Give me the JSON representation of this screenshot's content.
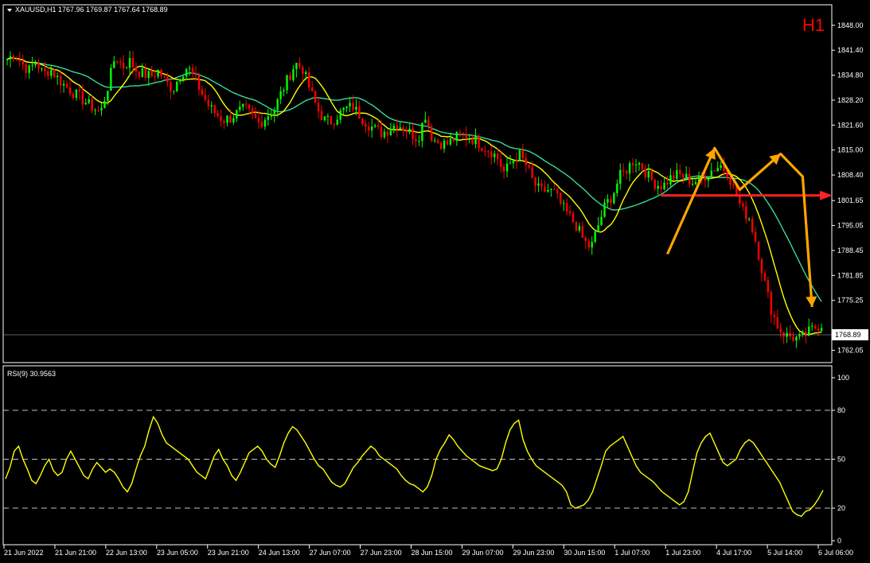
{
  "chart_data": [
    {
      "type": "candlestick",
      "symbol_header": "XAUUSD,H1  1767.96 1769.87 1767.64 1768.89",
      "timeframe_label": "H1",
      "current_price_label": "1768.89",
      "ylim": [
        1759.0,
        1853.0
      ],
      "y_ticks": [
        "1848.00",
        "1841.40",
        "1834.80",
        "1828.20",
        "1821.60",
        "1815.00",
        "1808.40",
        "1801.65",
        "1795.05",
        "1788.45",
        "1781.85",
        "1775.25",
        "1762.05"
      ],
      "x_labels": [
        "21 Jun 2022",
        "21 Jun 21:00",
        "22 Jun 13:00",
        "23 Jun 05:00",
        "23 Jun 21:00",
        "24 Jun 13:00",
        "27 Jun 07:00",
        "27 Jun 23:00",
        "28 Jun 15:00",
        "29 Jun 07:00",
        "29 Jun 23:00",
        "30 Jun 15:00",
        "1 Jul 07:00",
        "1 Jul 23:00",
        "4 Jul 17:00",
        "5 Jul 14:00",
        "6 Jul 06:00"
      ],
      "close_path": [
        1839.0,
        1840.5,
        1838.0,
        1836.0,
        1838.5,
        1835.0,
        1836.5,
        1834.0,
        1832.0,
        1830.5,
        1829.0,
        1827.5,
        1826.0,
        1825.0,
        1832.0,
        1840.0,
        1837.0,
        1838.5,
        1836.0,
        1835.0,
        1834.5,
        1836.0,
        1833.0,
        1831.0,
        1835.0,
        1837.0,
        1834.0,
        1830.0,
        1826.5,
        1824.5,
        1823.0,
        1823.5,
        1825.0,
        1826.0,
        1824.0,
        1822.0,
        1824.0,
        1825.5,
        1830.0,
        1834.0,
        1838.0,
        1836.5,
        1831.0,
        1826.0,
        1823.0,
        1822.5,
        1824.5,
        1826.0,
        1826.5,
        1824.0,
        1822.0,
        1820.5,
        1819.5,
        1820.5,
        1822.0,
        1821.0,
        1819.5,
        1818.0,
        1824.5,
        1818.0,
        1817.0,
        1816.5,
        1818.0,
        1819.0,
        1818.5,
        1817.5,
        1816.0,
        1815.0,
        1813.0,
        1809.0,
        1812.0,
        1814.0,
        1811.0,
        1806.5,
        1804.0,
        1804.5,
        1803.5,
        1800.0,
        1797.5,
        1795.0,
        1791.0,
        1789.0,
        1795.0,
        1800.5,
        1803.0,
        1808.0,
        1810.0,
        1812.5,
        1811.0,
        1808.0,
        1806.0,
        1805.5,
        1807.5,
        1808.5,
        1808.0,
        1806.5,
        1807.0,
        1808.5,
        1810.0,
        1811.0,
        1809.0,
        1804.0,
        1799.0,
        1797.0,
        1790.0,
        1781.0,
        1773.0,
        1768.0,
        1766.0,
        1765.5,
        1765.0,
        1766.5,
        1768.0,
        1768.89
      ],
      "ma_fast_label": "yellow moving average",
      "ma_slow_label": "green moving average",
      "ma_fast_color": "#ffff00",
      "ma_slow_color": "#33dd99",
      "bull_color": "#00ff00",
      "bear_color": "#ff0000",
      "annotation_arrow_color": "#ffa500",
      "support_line_color": "#ff2222",
      "support_level": 1803.0
    },
    {
      "type": "line",
      "label": "RSI(9) 30.9563",
      "ylim": [
        0,
        100
      ],
      "y_ticks": [
        "100",
        "80",
        "50",
        "20",
        "0"
      ],
      "levels": [
        80,
        50,
        20
      ],
      "color": "#ffff00",
      "values": [
        38,
        45,
        55,
        58,
        50,
        44,
        37,
        35,
        40,
        46,
        50,
        43,
        40,
        42,
        50,
        55,
        50,
        45,
        40,
        38,
        44,
        48,
        45,
        42,
        44,
        42,
        38,
        33,
        30,
        35,
        44,
        52,
        58,
        68,
        76,
        72,
        65,
        60,
        58,
        56,
        54,
        52,
        50,
        46,
        42,
        40,
        38,
        45,
        52,
        56,
        50,
        46,
        40,
        37,
        42,
        48,
        54,
        56,
        58,
        55,
        50,
        47,
        45,
        52,
        60,
        66,
        70,
        68,
        64,
        60,
        55,
        50,
        46,
        44,
        40,
        36,
        34,
        33,
        35,
        40,
        45,
        48,
        52,
        55,
        58,
        56,
        52,
        50,
        48,
        46,
        44,
        40,
        37,
        35,
        34,
        32,
        30,
        33,
        40,
        50,
        56,
        60,
        65,
        62,
        58,
        55,
        52,
        50,
        48,
        46,
        45,
        44,
        43,
        44,
        50,
        60,
        68,
        72,
        74,
        62,
        55,
        50,
        46,
        44,
        42,
        40,
        38,
        36,
        34,
        30,
        22,
        20,
        21,
        22,
        25,
        30,
        38,
        46,
        55,
        58,
        60,
        62,
        64,
        58,
        52,
        46,
        42,
        40,
        38,
        36,
        33,
        30,
        28,
        26,
        24,
        22,
        24,
        30,
        42,
        54,
        60,
        64,
        66,
        60,
        54,
        48,
        46,
        48,
        50,
        56,
        60,
        62,
        60,
        56,
        52,
        48,
        44,
        40,
        36,
        30,
        24,
        18,
        16,
        15,
        18,
        19,
        22,
        26,
        31
      ]
    }
  ]
}
